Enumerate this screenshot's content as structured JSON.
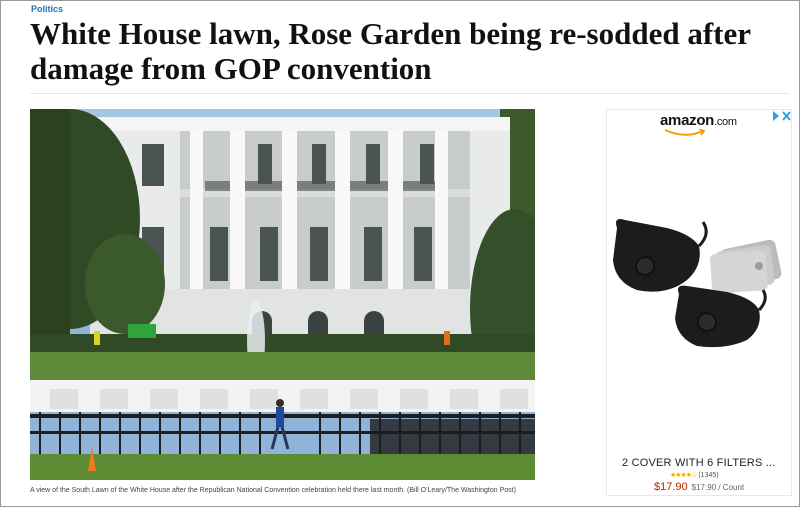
{
  "article": {
    "section": "Politics",
    "headline": "White House lawn, Rose Garden being re-sodded after damage from GOP convention",
    "caption": "A view of the South Lawn of the White House after the Republican National Convention celebration held there last month. (Bill O'Leary/The Washington Post)"
  },
  "ad": {
    "brand": "amazon",
    "brand_suffix": ".com",
    "adchoices_icon": "adchoices-icon",
    "product_title": "2 COVER WITH 6 FILTERS ...",
    "stars": "★★★★☆",
    "rating_count": "(1345)",
    "price": "$17.90",
    "price_per_count": "$17.90 / Count"
  },
  "colors": {
    "section_link": "#2a6ebb",
    "price": "#b12704",
    "amazon_smile": "#ff9900"
  }
}
